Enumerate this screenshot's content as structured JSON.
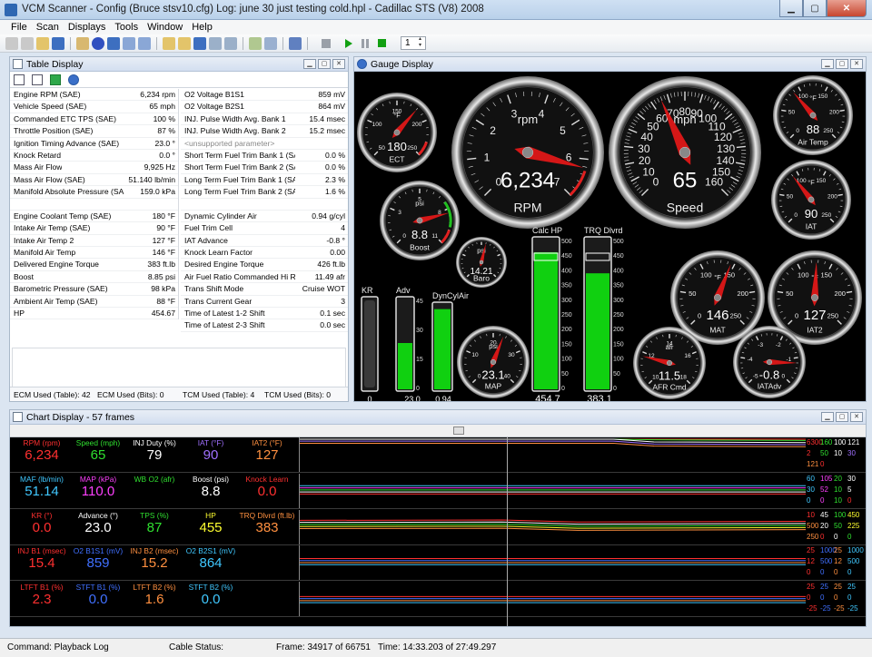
{
  "window": {
    "title": "VCM Scanner  -  Config  (Bruce stsv10.cfg)   Log:  june 30 just testing cold.hpl   -   Cadillac STS (V8) 2008"
  },
  "menu": [
    "File",
    "Scan",
    "Displays",
    "Tools",
    "Window",
    "Help"
  ],
  "toolbar": {
    "frame_step": "1"
  },
  "table_panel": {
    "title": "Table Display",
    "left": [
      {
        "name": "Engine RPM (SAE)",
        "value": "6,234 rpm"
      },
      {
        "name": "Vehicle Speed (SAE)",
        "value": "65 mph"
      },
      {
        "name": "Commanded ETC TPS (SAE)",
        "value": "100 %"
      },
      {
        "name": "Throttle Position (SAE)",
        "value": "87 %"
      },
      {
        "name": "Ignition Timing Advance (SAE)",
        "value": "23.0 °"
      },
      {
        "name": "Knock Retard",
        "value": "0.0 °"
      },
      {
        "name": "Mass Air Flow",
        "value": "9,925 Hz"
      },
      {
        "name": "Mass Air Flow (SAE)",
        "value": "51.140 lb/min"
      },
      {
        "name": "Manifold Absolute Pressure (SAE)",
        "value": "159.0 kPa"
      },
      {
        "name": "",
        "value": ""
      },
      {
        "name": "Engine Coolant Temp (SAE)",
        "value": "180 °F"
      },
      {
        "name": "Intake Air Temp (SAE)",
        "value": "90 °F"
      },
      {
        "name": "Intake Air Temp 2",
        "value": "127 °F"
      },
      {
        "name": "Manifold Air Temp",
        "value": "146 °F"
      },
      {
        "name": "Delivered Engine Torque",
        "value": "383 ft.lb"
      },
      {
        "name": "Boost",
        "value": "8.85 psi"
      },
      {
        "name": "Barometric Pressure (SAE)",
        "value": "98 kPa"
      },
      {
        "name": "Ambient Air Temp (SAE)",
        "value": "88 °F"
      },
      {
        "name": "HP",
        "value": "454.67"
      }
    ],
    "right": [
      {
        "name": "O2 Voltage B1S1",
        "value": "859 mV"
      },
      {
        "name": "O2 Voltage B2S1",
        "value": "864 mV"
      },
      {
        "name": "INJ. Pulse Width Avg. Bank 1",
        "value": "15.4 msec"
      },
      {
        "name": "INJ. Pulse Width Avg. Bank 2",
        "value": "15.2 msec"
      },
      {
        "name": "<unsupported parameter>",
        "value": ""
      },
      {
        "name": "Short Term Fuel Trim Bank 1 (SAE)",
        "value": "0.0 %"
      },
      {
        "name": "Short Term Fuel Trim Bank 2 (SAE)",
        "value": "0.0 %"
      },
      {
        "name": "Long Term Fuel Trim Bank 1 (SAE)",
        "value": "2.3 %"
      },
      {
        "name": "Long Term Fuel Trim Bank 2 (SAE)",
        "value": "1.6 %"
      },
      {
        "name": "",
        "value": ""
      },
      {
        "name": "Dynamic Cylinder Air",
        "value": "0.94 g/cyl"
      },
      {
        "name": "Fuel Trim Cell",
        "value": "4"
      },
      {
        "name": "IAT Advance",
        "value": "-0.8 °"
      },
      {
        "name": "Knock Learn Factor",
        "value": "0.00"
      },
      {
        "name": "Desired Engine Torque",
        "value": "426 ft.lb"
      },
      {
        "name": "Air Fuel Ratio Commanded Hi Res",
        "value": "11.49 afr"
      },
      {
        "name": "Trans Shift Mode",
        "value": "Cruise WOT"
      },
      {
        "name": "Trans Current Gear",
        "value": "3"
      },
      {
        "name": "Time of Latest 1-2 Shift",
        "value": "0.1 sec"
      },
      {
        "name": "Time of Latest 2-3 Shift",
        "value": "0.0 sec"
      }
    ],
    "status": {
      "ecm_table": "ECM Used (Table): 42",
      "ecm_bits": "ECM Used (Bits): 0",
      "tcm_table": "TCM Used (Table): 4",
      "tcm_bits": "TCM Used (Bits): 0"
    }
  },
  "gauge_panel": {
    "title": "Gauge Display",
    "dials": [
      {
        "id": "ect",
        "label": "ECT",
        "unit": "°F",
        "value_text": "180",
        "ticks": [
          "50",
          "100",
          "150",
          "200",
          "250"
        ],
        "fraction": 0.65
      },
      {
        "id": "rpm",
        "label": "RPM",
        "unit": "rpm",
        "value_text": "6,234",
        "ticks": [
          "0",
          "1",
          "2",
          "3",
          "4",
          "5",
          "6",
          "7"
        ],
        "fraction": 0.89
      },
      {
        "id": "speed",
        "label": "Speed",
        "unit": "mph",
        "value_text": "65",
        "ticks": [
          "0",
          "10",
          "20",
          "30",
          "40",
          "50",
          "60",
          "70",
          "80",
          "90",
          "100",
          "110",
          "120",
          "130",
          "140",
          "150",
          "160"
        ],
        "fraction": 0.41
      },
      {
        "id": "airtemp",
        "label": "Air Temp",
        "unit": "°F",
        "value_text": "88",
        "ticks": [
          "0",
          "50",
          "100",
          "150",
          "200",
          "250"
        ],
        "fraction": 0.35
      },
      {
        "id": "boost",
        "label": "Boost",
        "unit": "psi",
        "value_text": "8.8",
        "ticks": [
          "0",
          "3",
          "5",
          "8",
          "11"
        ],
        "fraction": 0.78
      },
      {
        "id": "iat",
        "label": "IAT",
        "unit": "°F",
        "value_text": "90",
        "ticks": [
          "0",
          "50",
          "100",
          "150",
          "200",
          "250"
        ],
        "fraction": 0.36
      },
      {
        "id": "baro",
        "label": "Baro",
        "unit": "psi",
        "value_text": "14.21",
        "ticks": [],
        "fraction": 0.55
      },
      {
        "id": "mat",
        "label": "MAT",
        "unit": "°F",
        "value_text": "146",
        "ticks": [
          "0",
          "50",
          "100",
          "150",
          "200",
          "250"
        ],
        "fraction": 0.58
      },
      {
        "id": "iat2",
        "label": "IAT2",
        "unit": "°F",
        "value_text": "127",
        "ticks": [
          "0",
          "50",
          "100",
          "150",
          "200",
          "250"
        ],
        "fraction": 0.51
      },
      {
        "id": "map",
        "label": "MAP",
        "unit": "psi",
        "value_text": "23.1",
        "ticks": [
          "0",
          "10",
          "20",
          "30",
          "40"
        ],
        "fraction": 0.58
      },
      {
        "id": "afrcmd",
        "label": "AFR Cmd",
        "unit": "afr",
        "value_text": "11.5",
        "ticks": [
          "10",
          "12",
          "14",
          "16",
          "18"
        ],
        "fraction": 0.22
      },
      {
        "id": "iatadv",
        "label": "IATAdv",
        "unit": "",
        "value_text": "-0.8",
        "ticks": [
          "-5",
          "-4",
          "-3",
          "-2",
          "-1",
          "0"
        ],
        "fraction": 0.84
      }
    ],
    "bars": [
      {
        "id": "kr",
        "label": "KR",
        "value_text": "0",
        "scale": [],
        "fraction": 0.0
      },
      {
        "id": "adv",
        "label": "Adv",
        "value_text": "23.0",
        "scale": [
          "45",
          "30",
          "15",
          "0"
        ],
        "fraction": 0.51
      },
      {
        "id": "dyncyl",
        "label": "DynCylAir",
        "value_text": "0.94",
        "scale": [],
        "fraction": 0.94
      },
      {
        "id": "calchp",
        "label": "Calc HP",
        "value_text": "454.7",
        "scale": [
          "500",
          "450",
          "400",
          "350",
          "300",
          "250",
          "200",
          "150",
          "100",
          "50",
          "0"
        ],
        "fraction": 0.91
      },
      {
        "id": "trq",
        "label": "TRQ Dlvrd",
        "value_text": "383.1",
        "scale": [
          "500",
          "450",
          "400",
          "350",
          "300",
          "250",
          "200",
          "150",
          "100",
          "50",
          "0"
        ],
        "fraction": 0.77
      }
    ]
  },
  "chart_panel": {
    "title": "Chart Display   -   57 frames",
    "rows": [
      {
        "cells": [
          {
            "label": "RPM (rpm)",
            "value": "6,234",
            "color": "#ff3030"
          },
          {
            "label": "Speed (mph)",
            "value": "65",
            "color": "#30e030"
          },
          {
            "label": "INJ Duty (%)",
            "value": "79",
            "color": "#ffffff"
          },
          {
            "label": "IAT (°F)",
            "value": "90",
            "color": "#a070ff"
          },
          {
            "label": "IAT2 (°F)",
            "value": "127",
            "color": "#ff9040"
          }
        ],
        "scale": [
          {
            "t": "6300",
            "c": "#ff3030"
          },
          {
            "t": "160",
            "c": "#30e030"
          },
          {
            "t": "100",
            "c": "#ffffff"
          },
          {
            "t": "121",
            "c": "#ffffff"
          },
          {
            "t": "2",
            "c": "#ff3030"
          },
          {
            "t": "50",
            "c": "#30e030"
          },
          {
            "t": "10",
            "c": "#ffffff"
          },
          {
            "t": "30",
            "c": "#a070ff"
          },
          {
            "t": "121",
            "c": "#ff9040"
          },
          {
            "t": "0",
            "c": "#ff3030"
          }
        ]
      },
      {
        "cells": [
          {
            "label": "MAF (lb/min)",
            "value": "51.14",
            "color": "#40c8ff"
          },
          {
            "label": "MAP (kPa)",
            "value": "110.0",
            "color": "#ff40ff"
          },
          {
            "label": "WB O2 (afr)",
            "value": "",
            "color": "#30e030"
          },
          {
            "label": "Boost (psi)",
            "value": "8.8",
            "color": "#ffffff"
          },
          {
            "label": "Knock Learn",
            "value": "0.0",
            "color": "#ff3030"
          }
        ],
        "scale": [
          {
            "t": "60",
            "c": "#40c8ff"
          },
          {
            "t": "105",
            "c": "#ff40ff"
          },
          {
            "t": "20",
            "c": "#30e030"
          },
          {
            "t": "30",
            "c": "#ffffff"
          },
          {
            "t": "30",
            "c": "#40c8ff"
          },
          {
            "t": "52",
            "c": "#ff40ff"
          },
          {
            "t": "10",
            "c": "#30e030"
          },
          {
            "t": "5",
            "c": "#ffffff"
          },
          {
            "t": "0",
            "c": "#40c8ff"
          },
          {
            "t": "0",
            "c": "#ff40ff"
          },
          {
            "t": "10",
            "c": "#30e030"
          },
          {
            "t": "0",
            "c": "#ff3030"
          }
        ]
      },
      {
        "cells": [
          {
            "label": "KR (°)",
            "value": "0.0",
            "color": "#ff3030"
          },
          {
            "label": "Advance (°)",
            "value": "23.0",
            "color": "#ffffff"
          },
          {
            "label": "TPS (%)",
            "value": "87",
            "color": "#30e030"
          },
          {
            "label": "HP",
            "value": "455",
            "color": "#ffff30"
          },
          {
            "label": "TRQ Dlvrd (ft.lb)",
            "value": "383",
            "color": "#ff9040"
          }
        ],
        "scale": [
          {
            "t": "10",
            "c": "#ff3030"
          },
          {
            "t": "45",
            "c": "#ffffff"
          },
          {
            "t": "100",
            "c": "#30e030"
          },
          {
            "t": "450",
            "c": "#ffff30"
          },
          {
            "t": "500",
            "c": "#ff9040"
          },
          {
            "t": "20",
            "c": "#ffffff"
          },
          {
            "t": "50",
            "c": "#30e030"
          },
          {
            "t": "225",
            "c": "#ffff30"
          },
          {
            "t": "250",
            "c": "#ff9040"
          },
          {
            "t": "0",
            "c": "#ff3030"
          },
          {
            "t": "0",
            "c": "#ffffff"
          },
          {
            "t": "0",
            "c": "#30e030"
          }
        ]
      },
      {
        "cells": [
          {
            "label": "INJ B1 (msec)",
            "value": "15.4",
            "color": "#ff3030"
          },
          {
            "label": "O2 B1S1 (mV)",
            "value": "859",
            "color": "#4070ff"
          },
          {
            "label": "INJ B2 (msec)",
            "value": "15.2",
            "color": "#ff9040"
          },
          {
            "label": "O2 B2S1 (mV)",
            "value": "864",
            "color": "#40c8ff"
          }
        ],
        "scale": [
          {
            "t": "25",
            "c": "#ff3030"
          },
          {
            "t": "1000",
            "c": "#4070ff"
          },
          {
            "t": "25",
            "c": "#ff9040"
          },
          {
            "t": "1000",
            "c": "#40c8ff"
          },
          {
            "t": "12",
            "c": "#ff3030"
          },
          {
            "t": "500",
            "c": "#4070ff"
          },
          {
            "t": "12",
            "c": "#ff9040"
          },
          {
            "t": "500",
            "c": "#40c8ff"
          },
          {
            "t": "0",
            "c": "#ff3030"
          },
          {
            "t": "0",
            "c": "#4070ff"
          },
          {
            "t": "0",
            "c": "#ff9040"
          },
          {
            "t": "0",
            "c": "#40c8ff"
          }
        ]
      },
      {
        "cells": [
          {
            "label": "LTFT B1 (%)",
            "value": "2.3",
            "color": "#ff3030"
          },
          {
            "label": "STFT B1 (%)",
            "value": "0.0",
            "color": "#4070ff"
          },
          {
            "label": "LTFT B2 (%)",
            "value": "1.6",
            "color": "#ff9040"
          },
          {
            "label": "STFT B2 (%)",
            "value": "0.0",
            "color": "#40c8ff"
          }
        ],
        "scale": [
          {
            "t": "25",
            "c": "#ff3030"
          },
          {
            "t": "25",
            "c": "#4070ff"
          },
          {
            "t": "25",
            "c": "#ff9040"
          },
          {
            "t": "25",
            "c": "#40c8ff"
          },
          {
            "t": "0",
            "c": "#ff3030"
          },
          {
            "t": "0",
            "c": "#4070ff"
          },
          {
            "t": "0",
            "c": "#ff9040"
          },
          {
            "t": "0",
            "c": "#40c8ff"
          },
          {
            "t": "-25",
            "c": "#ff3030"
          },
          {
            "t": "-25",
            "c": "#4070ff"
          },
          {
            "t": "-25",
            "c": "#ff9040"
          },
          {
            "t": "-25",
            "c": "#40c8ff"
          }
        ]
      }
    ]
  },
  "statusbar": {
    "command": "Command:   Playback Log",
    "cable": "Cable Status:",
    "frame": "Frame:  34917 of 66751",
    "time": "Time:  14:33.203 of 27:49.297"
  }
}
